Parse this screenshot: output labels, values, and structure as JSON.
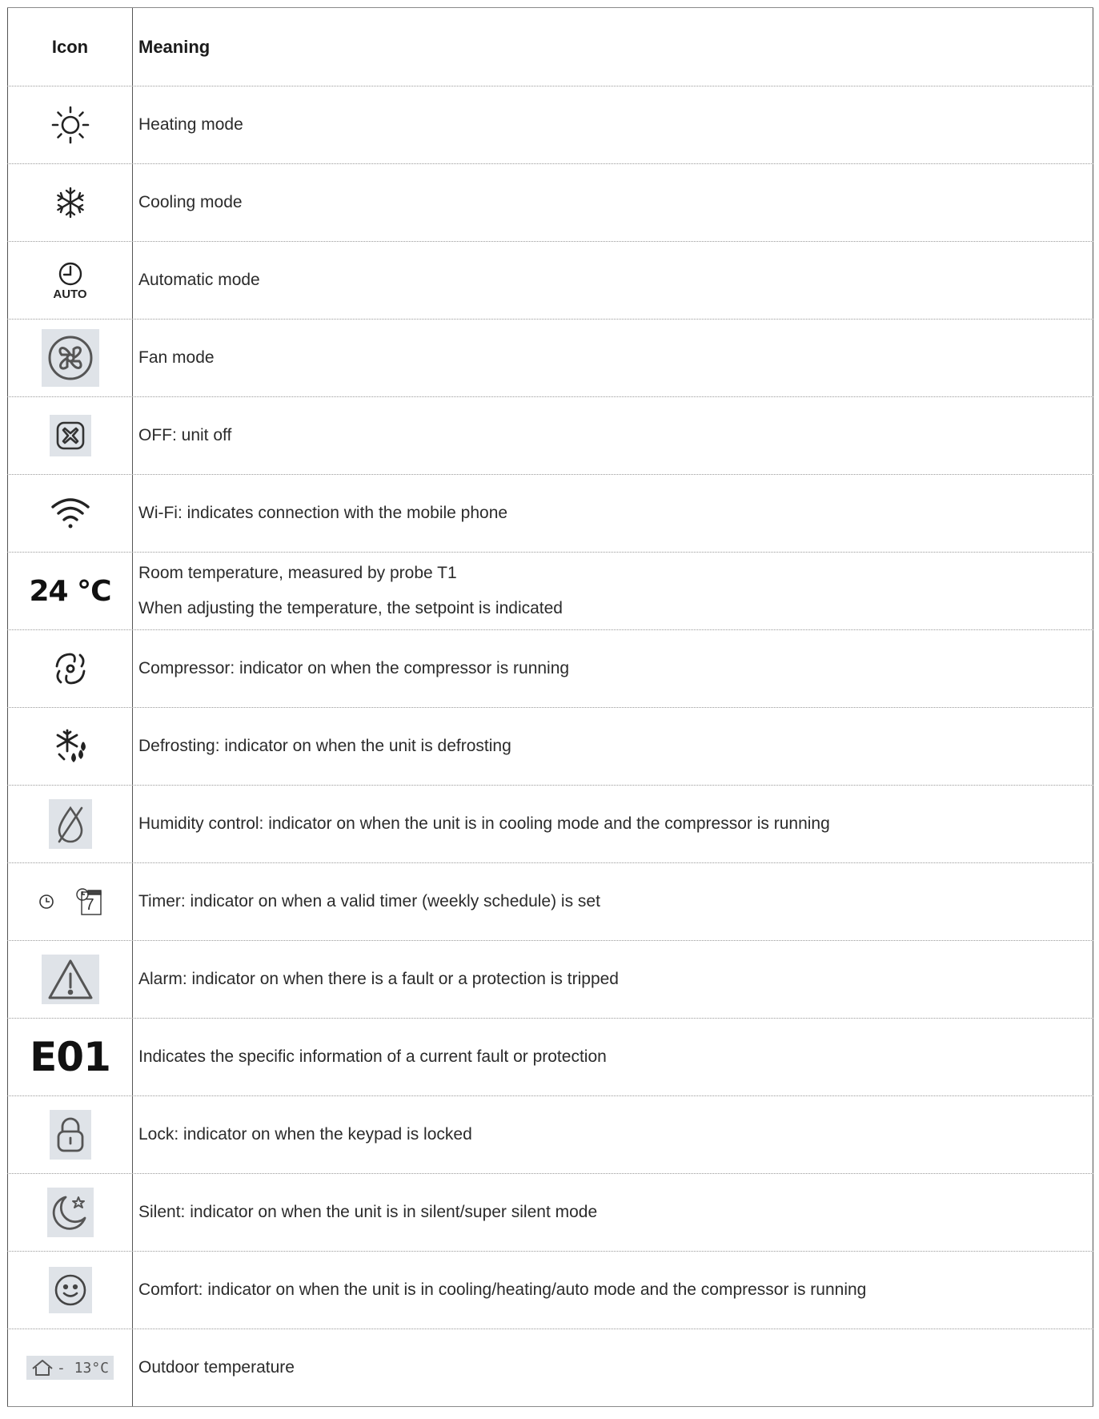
{
  "table": {
    "header": {
      "icon": "Icon",
      "meaning": "Meaning"
    },
    "rows": [
      {
        "icon": "sun-icon",
        "meaning": "Heating mode"
      },
      {
        "icon": "snowflake-icon",
        "meaning": "Cooling mode"
      },
      {
        "icon": "auto-clock-icon",
        "icon_text": "AUTO",
        "meaning": "Automatic mode"
      },
      {
        "icon": "fan-icon",
        "meaning": "Fan mode"
      },
      {
        "icon": "off-icon",
        "meaning": "OFF: unit off"
      },
      {
        "icon": "wifi-icon",
        "meaning": "Wi-Fi: indicates connection with the mobile phone"
      },
      {
        "icon": "temperature-text",
        "icon_text": "24 °C",
        "meaning": "Room temperature, measured by probe T1",
        "meaning_line2": "When adjusting the temperature, the setpoint is indicated"
      },
      {
        "icon": "compressor-icon",
        "meaning": "Compressor: indicator on when the compressor is running"
      },
      {
        "icon": "defrost-icon",
        "meaning": "Defrosting: indicator on when the unit is defrosting"
      },
      {
        "icon": "humidity-icon",
        "meaning": "Humidity control: indicator on when the unit is in cooling mode and the compressor is running"
      },
      {
        "icon": "timer-icon",
        "icon_text": "7",
        "meaning": "Timer: indicator on when a valid timer (weekly schedule) is set"
      },
      {
        "icon": "alarm-icon",
        "meaning": "Alarm: indicator on when there is a fault or a protection is tripped"
      },
      {
        "icon": "error-code-text",
        "icon_text": "E01",
        "meaning": "Indicates the specific information of a current fault or protection"
      },
      {
        "icon": "lock-icon",
        "meaning": "Lock: indicator on when the keypad is locked"
      },
      {
        "icon": "silent-icon",
        "meaning": "Silent: indicator on when the unit is in silent/super silent mode"
      },
      {
        "icon": "comfort-icon",
        "meaning": "Comfort: indicator on when the unit is in cooling/heating/auto mode and the compressor is running"
      },
      {
        "icon": "outdoor-temperature-icon",
        "icon_text": "- 13°C",
        "meaning": "Outdoor temperature"
      }
    ]
  }
}
